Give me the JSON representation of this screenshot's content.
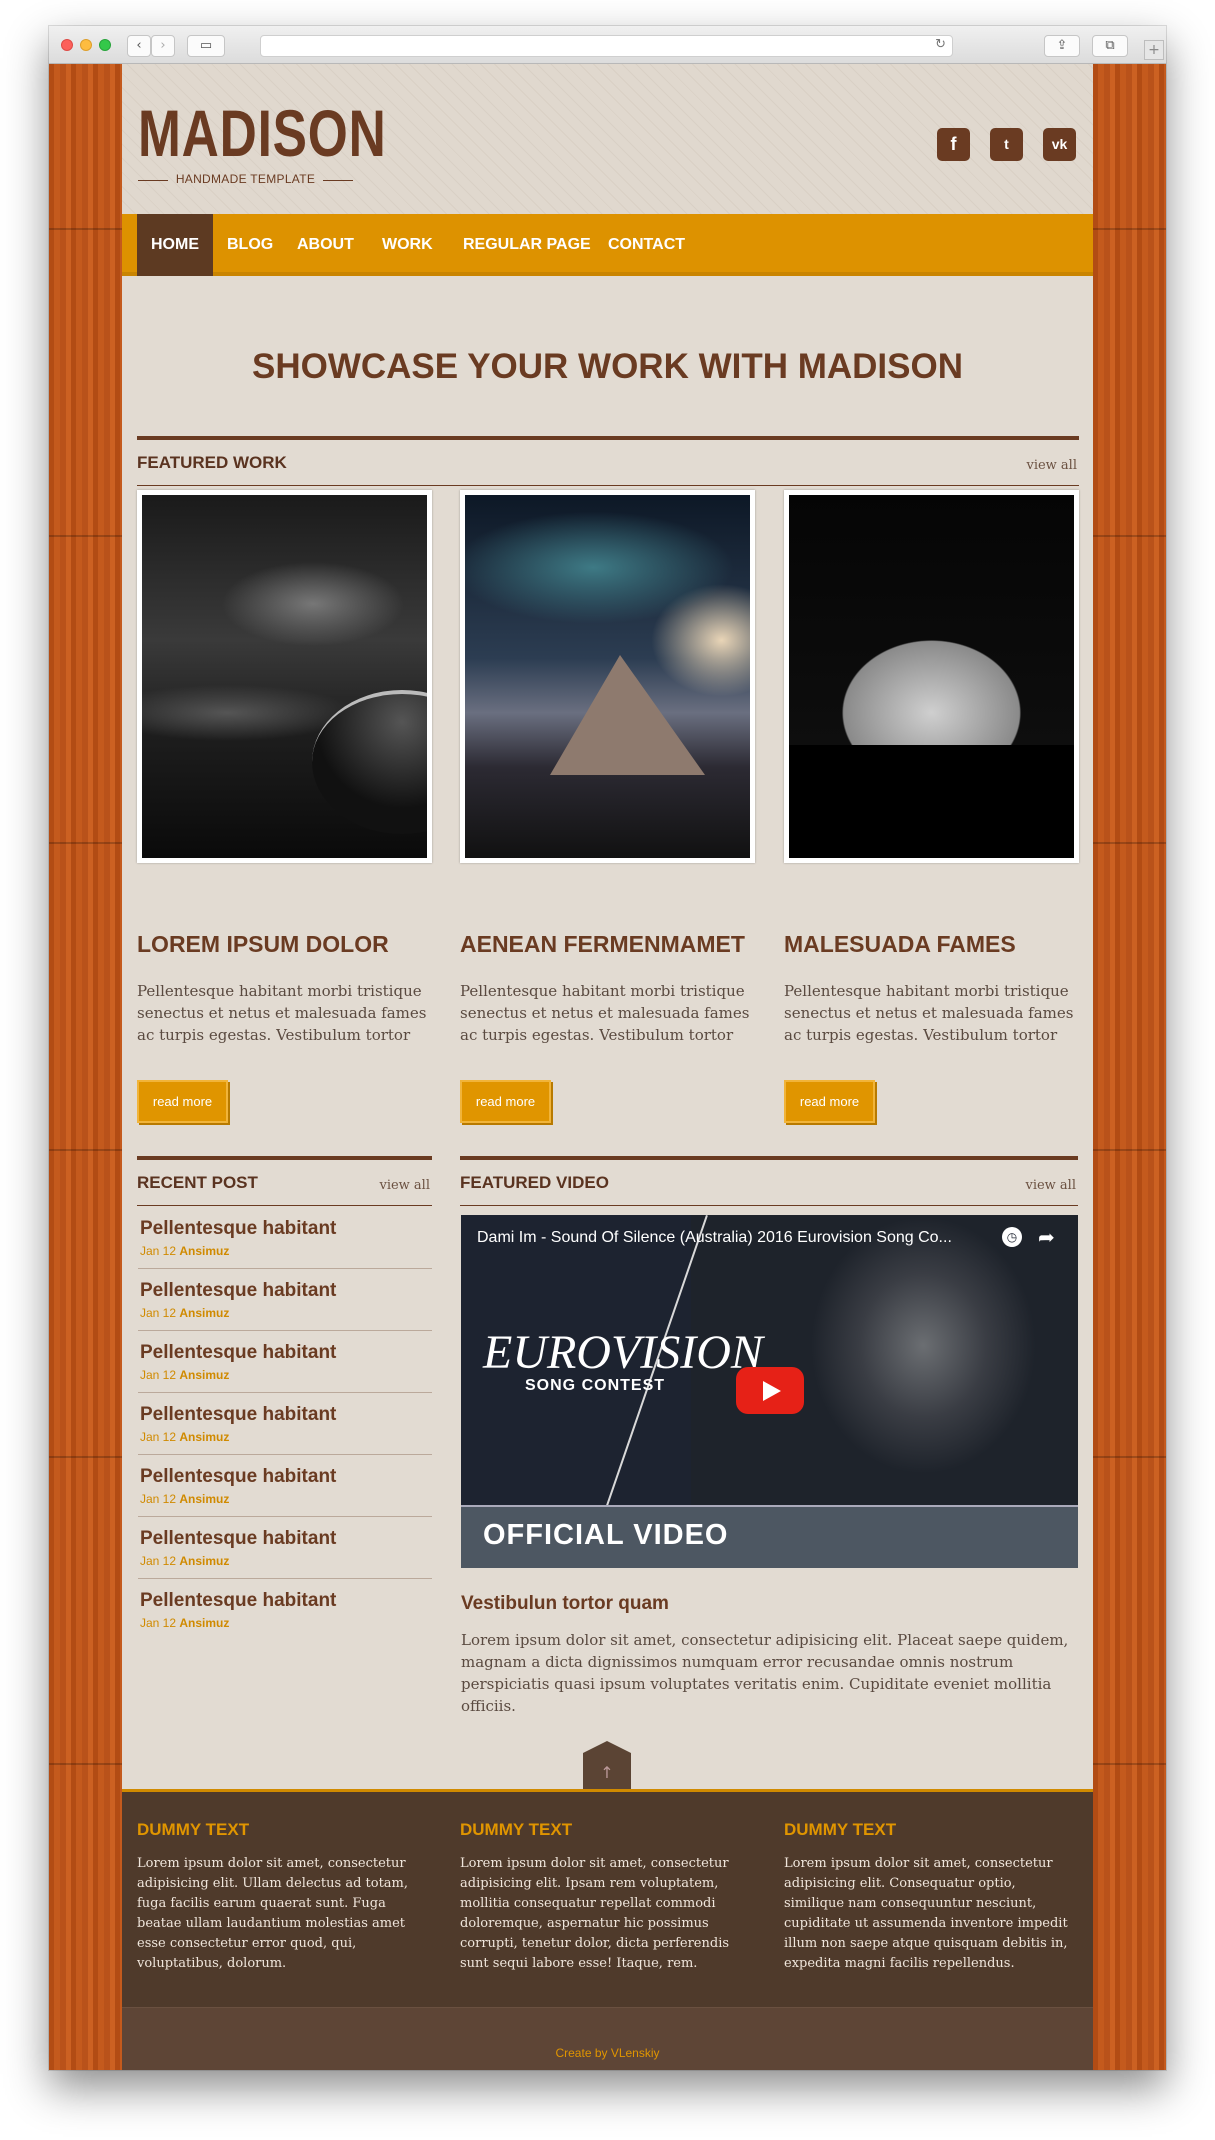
{
  "browser": {
    "back_icon": "‹",
    "forward_icon": "›",
    "sidebar_icon": "▭",
    "reload_icon": "↻",
    "share_icon": "⇪",
    "tabs_icon": "⧉",
    "new_tab_icon": "+"
  },
  "site": {
    "logo": "MADISON",
    "tagline": "HANDMADE TEMPLATE",
    "social": {
      "facebook": "f",
      "twitter": "t",
      "vk": "vk"
    }
  },
  "nav": [
    "HOME",
    "BLOG",
    "ABOUT",
    "WORK",
    "REGULAR PAGE",
    "CONTACT"
  ],
  "hero_title": "SHOWCASE YOUR WORK WITH MADISON",
  "featured_work": {
    "heading": "FEATURED WORK",
    "view_all": "view all",
    "cards": [
      {
        "title": "LOREM IPSUM DOLOR",
        "text": "Pellentesque habitant morbi tristique senectus et netus et malesuada fames ac turpis egestas. Vestibulum tortor",
        "button": "read more"
      },
      {
        "title": "AENEAN FERMENMAMET",
        "text": "Pellentesque habitant morbi tristique senectus et netus et malesuada fames ac turpis egestas. Vestibulum tortor",
        "button": "read more"
      },
      {
        "title": "MALESUADA FAMES",
        "text": "Pellentesque habitant morbi tristique senectus et netus et malesuada fames ac turpis egestas. Vestibulum tortor",
        "button": "read more"
      }
    ]
  },
  "recent_post": {
    "heading": "RECENT POST",
    "view_all": "view all",
    "items": [
      {
        "title": "Pellentesque habitant",
        "date": "Jan 12",
        "author": "Ansimuz"
      },
      {
        "title": "Pellentesque habitant",
        "date": "Jan 12",
        "author": "Ansimuz"
      },
      {
        "title": "Pellentesque habitant",
        "date": "Jan 12",
        "author": "Ansimuz"
      },
      {
        "title": "Pellentesque habitant",
        "date": "Jan 12",
        "author": "Ansimuz"
      },
      {
        "title": "Pellentesque habitant",
        "date": "Jan 12",
        "author": "Ansimuz"
      },
      {
        "title": "Pellentesque habitant",
        "date": "Jan 12",
        "author": "Ansimuz"
      },
      {
        "title": "Pellentesque habitant",
        "date": "Jan 12",
        "author": "Ansimuz"
      }
    ]
  },
  "featured_video": {
    "heading": "FEATURED VIDEO",
    "view_all": "view all",
    "video_title": "Dami Im - Sound Of Silence (Australia) 2016 Eurovision Song Co...",
    "logo_text": "EUROVISION",
    "logo_sub": "SONG CONTEST",
    "banner": "OFFICIAL VIDEO",
    "clock_icon": "◷",
    "share_icon": "➦",
    "caption_title": "Vestibulun tortor quam",
    "caption_text": "Lorem ipsum dolor sit amet, consectetur adipisicing elit. Placeat saepe quidem, magnam a dicta dignissimos numquam error recusandae omnis nostrum perspiciatis quasi ipsum voluptates veritatis enim. Cupiditate eveniet mollitia officiis."
  },
  "footer": {
    "to_top_icon": "↑",
    "columns": [
      {
        "title": "DUMMY TEXT",
        "text": "Lorem ipsum dolor sit amet, consectetur adipisicing elit. Ullam delectus ad totam, fuga facilis earum quaerat sunt. Fuga beatae ullam laudantium molestias amet esse consectetur error quod, qui, voluptatibus, dolorum."
      },
      {
        "title": "DUMMY TEXT",
        "text": "Lorem ipsum dolor sit amet, consectetur adipisicing elit. Ipsam rem voluptatem, mollitia consequatur repellat commodi doloremque, aspernatur hic possimus corrupti, tenetur dolor, dicta perferendis sunt sequi labore esse! Itaque, rem."
      },
      {
        "title": "DUMMY TEXT",
        "text": "Lorem ipsum dolor sit amet, consectetur adipisicing elit. Consequatur optio, similique nam consequuntur nesciunt, cupiditate ut assumenda inventore impedit illum non saepe atque quisquam debitis in, expedita magni facilis repellendus."
      }
    ],
    "copyright": "Create by VLenskiy"
  },
  "colors": {
    "brown": "#6a3b22",
    "orange": "#dd9200",
    "background": "#e2dbd2",
    "footer": "#4f3a2b"
  }
}
